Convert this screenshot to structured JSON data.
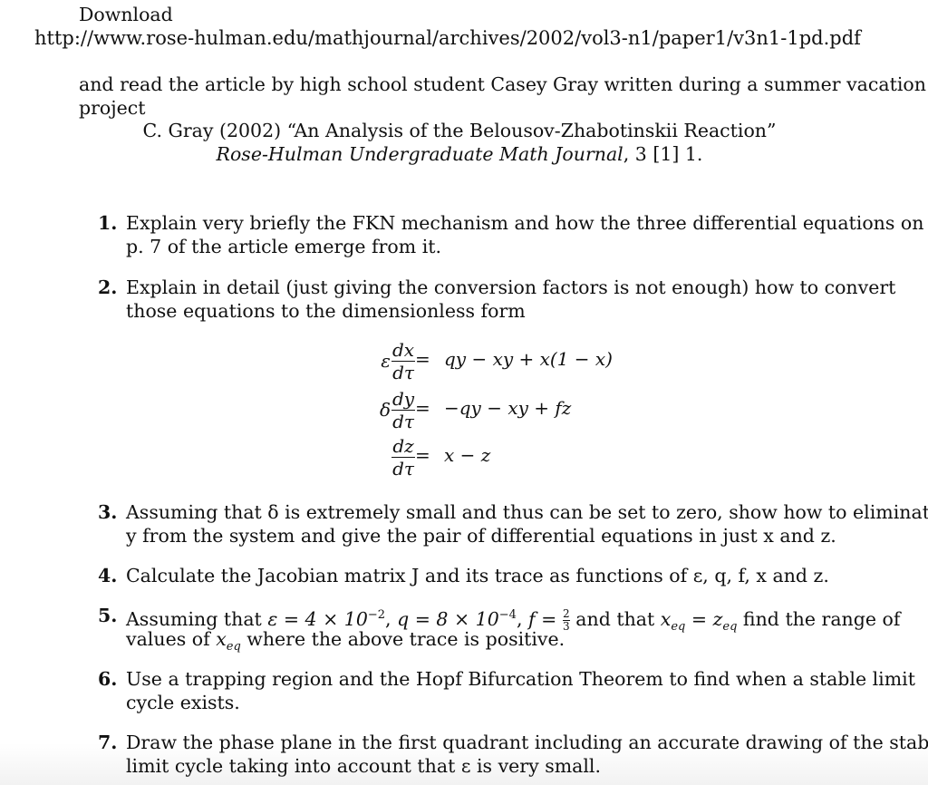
{
  "header": {
    "download_label": "Download",
    "url": "http://www.rose-hulman.edu/mathjournal/archives/2002/vol3-n1/paper1/v3n1-1pd.pdf"
  },
  "intro": {
    "line1": "and read the article by high school student Casey Gray written during a summer vacation",
    "line2": "project"
  },
  "citation": {
    "line1": "C. Gray (2002) “An Analysis of the Belousov-Zhabotinskii Reaction”",
    "journal": "Rose-Hulman Undergraduate Math Journal",
    "suffix": ", 3 [1] 1."
  },
  "equations": [
    {
      "coef": "ε",
      "num": "dx",
      "den": "dτ",
      "eq": "=",
      "rhs": "qy − xy + x(1 − x)"
    },
    {
      "coef": "δ",
      "num": "dy",
      "den": "dτ",
      "eq": "=",
      "rhs": "−qy − xy + fz"
    },
    {
      "coef": "",
      "num": "dz",
      "den": "dτ",
      "eq": "=",
      "rhs": "x − z"
    }
  ],
  "questions": [
    {
      "number": "1.",
      "line1": "Explain very briefly the FKN mechanism and how the three differential equations on",
      "line2": "p. 7 of the article emerge from it."
    },
    {
      "number": "2.",
      "line1": "Explain in detail (just giving the conversion factors is not enough) how to convert",
      "line2": "those equations to the dimensionless form"
    },
    {
      "number": "3.",
      "line1": "Assuming that δ is extremely small and thus can be set to zero, show how to eliminate",
      "line2": "y from the system and give the pair of differential equations in just x and z."
    },
    {
      "number": "4.",
      "line1": "Calculate the Jacobian matrix J and its trace as functions of ε, q, f, x and z."
    },
    {
      "number": "5.",
      "line1_parts": {
        "a": "Assuming that ",
        "eps": "ε = 4 × 10",
        "eps_exp": "−2",
        "sep1": ", ",
        "q": "q = 8 × 10",
        "q_exp": "−4",
        "sep2": ", ",
        "f": "f = ",
        "f_num": "2",
        "f_den": "3",
        "b": " and that ",
        "x": "x",
        "x_sub": "eq",
        "eq": " = ",
        "z": "z",
        "z_sub": "eq",
        "c": " find the range of"
      },
      "line2_parts": {
        "a": "values of ",
        "x": "x",
        "x_sub": "eq",
        "b": " where the above trace is positive."
      }
    },
    {
      "number": "6.",
      "line1": "Use a trapping region and the Hopf Bifurcation Theorem to find when a stable limit",
      "line2": "cycle exists."
    },
    {
      "number": "7.",
      "line1": "Draw the phase plane in the first quadrant including an accurate drawing of the stable",
      "line2": "limit cycle taking into account that ε is very small."
    }
  ]
}
